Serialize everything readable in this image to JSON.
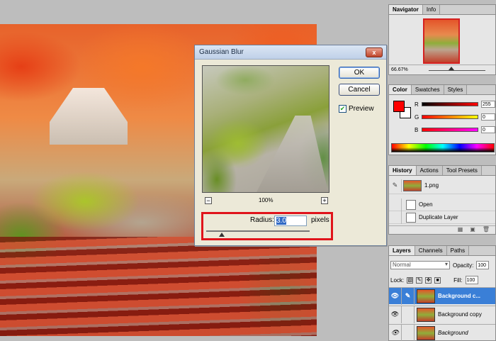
{
  "navigator": {
    "tabs": [
      "Navigator",
      "Info"
    ],
    "zoom": "66.67%"
  },
  "color": {
    "tabs": [
      "Color",
      "Swatches",
      "Styles"
    ],
    "channels": [
      {
        "label": "R",
        "value": "255"
      },
      {
        "label": "G",
        "value": "0"
      },
      {
        "label": "B",
        "value": "0"
      }
    ],
    "foreground_color": "#ff0000",
    "background_color": "#ffffff"
  },
  "history": {
    "tabs": [
      "History",
      "Actions",
      "Tool Presets"
    ],
    "snapshot": "1.png",
    "steps": [
      "Open",
      "Duplicate Layer"
    ]
  },
  "layers": {
    "tabs": [
      "Layers",
      "Channels",
      "Paths"
    ],
    "blend_mode": "Normal",
    "opacity_label": "Opacity:",
    "opacity_value": "100",
    "lock_label": "Lock:",
    "fill_label": "Fill:",
    "fill_value": "100",
    "items": [
      {
        "name": "Background c...",
        "selected": true
      },
      {
        "name": "Background copy",
        "selected": false
      },
      {
        "name": "Background",
        "selected": false
      }
    ]
  },
  "dialog": {
    "title": "Gaussian Blur",
    "close_label": "x",
    "ok_label": "OK",
    "cancel_label": "Cancel",
    "preview_label": "Preview",
    "preview_checked": true,
    "zoom_level": "100%",
    "zoom_out_label": "−",
    "zoom_in_label": "+",
    "radius_label": "Radius:",
    "radius_value": "3.0",
    "radius_unit": "pixels"
  }
}
